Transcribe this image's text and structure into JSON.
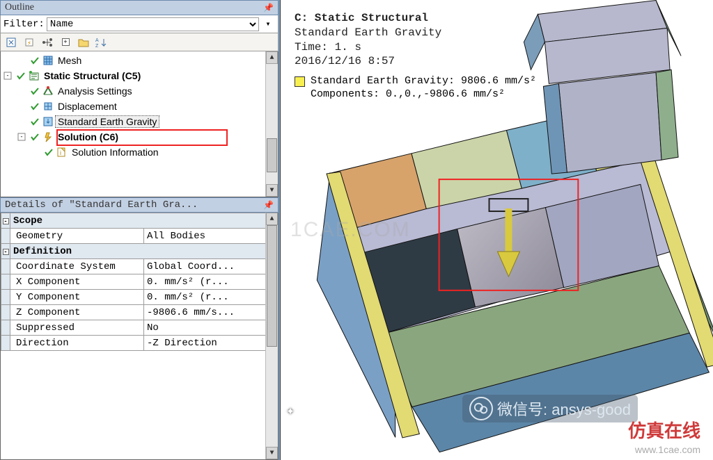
{
  "outline": {
    "title": "Outline",
    "filter_label": "Filter:",
    "filter_value": "Name",
    "toolbar": {
      "refresh": "refresh",
      "flash": "flash",
      "branch": "branch",
      "expand": "+",
      "folder": "folder",
      "sort": "A/Z"
    },
    "scrollbar": {
      "pos_pct": 62,
      "size_pct": 28
    },
    "tree": [
      {
        "level": 2,
        "exp": null,
        "icon": "mesh-icon",
        "label": "Mesh",
        "bold": false,
        "selected": false,
        "interactable": true
      },
      {
        "level": 1,
        "exp": "-",
        "icon": "env-icon",
        "label": "Static Structural (C5)",
        "bold": true,
        "selected": false,
        "interactable": true
      },
      {
        "level": 2,
        "exp": null,
        "icon": "settings-icon",
        "label": "Analysis Settings",
        "bold": false,
        "selected": false,
        "interactable": true
      },
      {
        "level": 2,
        "exp": null,
        "icon": "disp-icon",
        "label": "Displacement",
        "bold": false,
        "selected": false,
        "interactable": true
      },
      {
        "level": 2,
        "exp": null,
        "icon": "grav-icon",
        "label": "Standard Earth Gravity",
        "bold": false,
        "selected": true,
        "interactable": true
      },
      {
        "level": 2,
        "exp": "-",
        "icon": "solution-icon",
        "label": "Solution (C6)",
        "bold": true,
        "selected": false,
        "interactable": true
      },
      {
        "level": 3,
        "exp": null,
        "icon": "info-icon",
        "label": "Solution Information",
        "bold": false,
        "selected": false,
        "interactable": true
      }
    ]
  },
  "details": {
    "title": "Details of \"Standard Earth Gra...",
    "groups": [
      {
        "name": "Scope",
        "rows": [
          {
            "label": "Geometry",
            "value": "All Bodies"
          }
        ]
      },
      {
        "name": "Definition",
        "rows": [
          {
            "label": "Coordinate System",
            "value": "Global Coord..."
          },
          {
            "label": "X Component",
            "value": "0. mm/s²  (r..."
          },
          {
            "label": "Y Component",
            "value": "0. mm/s²  (r..."
          },
          {
            "label": "Z Component",
            "value": "-9806.6 mm/s..."
          },
          {
            "label": "Suppressed",
            "value": "No"
          },
          {
            "label": "Direction",
            "value": "-Z Direction"
          }
        ]
      }
    ]
  },
  "viewport": {
    "title": "C: Static Structural",
    "subtitle": "Standard Earth Gravity",
    "time": "Time: 1. s",
    "timestamp": "2016/12/16 8:57",
    "legend_color": "#f8f050",
    "legend_line1": "Standard Earth Gravity: 9806.6 mm/s²",
    "legend_line2": "Components: 0.,0.,-9806.6 mm/s²",
    "wechat_prefix": "微信号:",
    "wechat_id": "ansys-good",
    "credit_cn": "仿真在线",
    "credit_url": "www.1cae.com",
    "watermark": "1CAE.COM"
  }
}
